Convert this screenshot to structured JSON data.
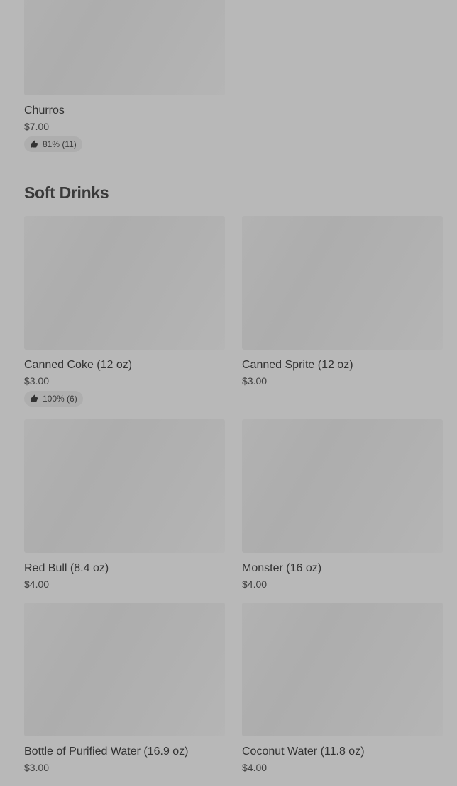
{
  "top_items": [
    {
      "name": "Churros",
      "price": "$7.00",
      "rating": "81% (11)"
    }
  ],
  "section": {
    "title": "Soft Drinks",
    "items": [
      {
        "name": "Canned Coke (12 oz)",
        "price": "$3.00",
        "rating": "100% (6)"
      },
      {
        "name": "Canned Sprite (12 oz)",
        "price": "$3.00"
      },
      {
        "name": "Red Bull (8.4 oz)",
        "price": "$4.00"
      },
      {
        "name": "Monster (16 oz)",
        "price": "$4.00"
      },
      {
        "name": "Bottle of Purified Water (16.9 oz)",
        "price": "$3.00"
      },
      {
        "name": "Coconut Water (11.8 oz)",
        "price": "$4.00"
      }
    ]
  },
  "icons": {
    "rating": "thumbs-up-icon"
  },
  "colors": {
    "background": "#b8b8b8",
    "text": "#333333",
    "badge": "#aeaeae"
  }
}
